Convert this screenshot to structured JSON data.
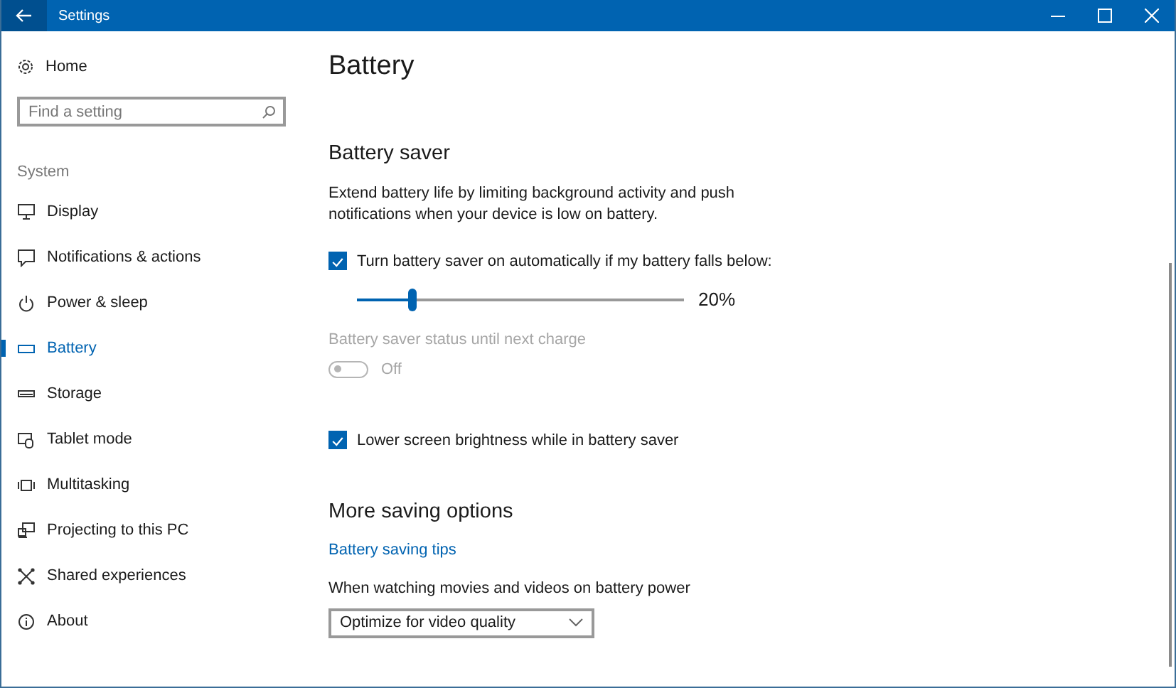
{
  "window": {
    "title": "Settings"
  },
  "sidebar": {
    "home": {
      "label": "Home"
    },
    "search": {
      "placeholder": "Find a setting"
    },
    "section": "System",
    "items": [
      {
        "label": "Display",
        "selected": false
      },
      {
        "label": "Notifications & actions",
        "selected": false
      },
      {
        "label": "Power & sleep",
        "selected": false
      },
      {
        "label": "Battery",
        "selected": true
      },
      {
        "label": "Storage",
        "selected": false
      },
      {
        "label": "Tablet mode",
        "selected": false
      },
      {
        "label": "Multitasking",
        "selected": false
      },
      {
        "label": "Projecting to this PC",
        "selected": false
      },
      {
        "label": "Shared experiences",
        "selected": false
      },
      {
        "label": "About",
        "selected": false
      }
    ]
  },
  "content": {
    "title": "Battery",
    "battery_saver": {
      "heading": "Battery saver",
      "description": "Extend battery life by limiting background activity and push notifications when your device is low on battery.",
      "auto_checkbox": {
        "label": "Turn battery saver on automatically if my battery falls below:",
        "checked": true
      },
      "threshold": {
        "level": 0.17,
        "reading": "20%"
      },
      "status": {
        "label": "Battery saver status until next charge",
        "disabled": true,
        "on": false,
        "state_text": "Off"
      },
      "brightness_checkbox": {
        "label": "Lower screen brightness while in battery saver",
        "checked": true
      }
    },
    "more_options": {
      "heading": "More saving options",
      "link": "Battery saving tips",
      "video_label": "When watching movies and videos on battery power",
      "dropdown": {
        "value": "Optimize for video quality"
      }
    }
  }
}
